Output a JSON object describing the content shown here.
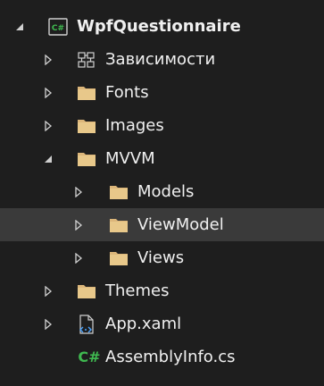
{
  "colors": {
    "background": "#1e1e1e",
    "selected_row": "#3a3a3a",
    "text": "#f0f0f0",
    "folder": "#dcb67a",
    "csharp": "#3fb950",
    "chevron": "#d0d0d0"
  },
  "tree": {
    "project": {
      "label": "WpfQuestionnaire",
      "icon": "csharp-project-icon",
      "expanded": true
    },
    "dependencies": {
      "label": "Зависимости",
      "icon": "dependencies-icon",
      "expanded": false
    },
    "fonts": {
      "label": "Fonts",
      "icon": "folder-icon",
      "expanded": false
    },
    "images": {
      "label": "Images",
      "icon": "folder-icon",
      "expanded": false
    },
    "mvvm": {
      "label": "MVVM",
      "icon": "folder-icon",
      "expanded": true
    },
    "models": {
      "label": "Models",
      "icon": "folder-icon",
      "expanded": false
    },
    "viewmodel": {
      "label": "ViewModel",
      "icon": "folder-icon",
      "expanded": false,
      "selected": true
    },
    "views": {
      "label": "Views",
      "icon": "folder-icon",
      "expanded": false
    },
    "themes": {
      "label": "Themes",
      "icon": "folder-icon",
      "expanded": false
    },
    "app_xaml": {
      "label": "App.xaml",
      "icon": "xaml-file-icon",
      "expanded": false
    },
    "assemblyinfo": {
      "label": "AssemblyInfo.cs",
      "icon": "csharp-file-icon",
      "csharp_glyph": "C#"
    }
  }
}
